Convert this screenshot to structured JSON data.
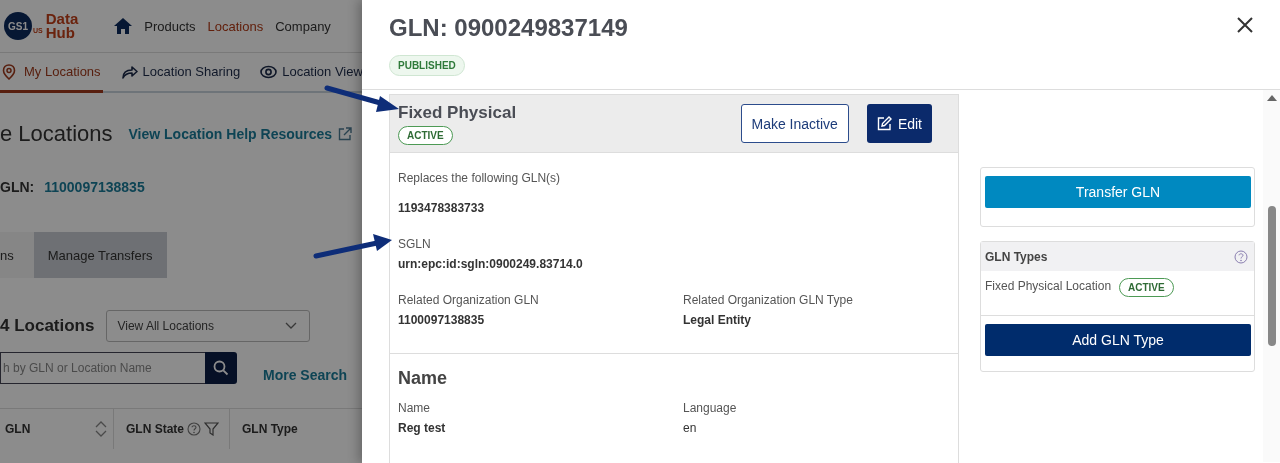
{
  "background_page": {
    "logo": {
      "mark": "GS1",
      "region": "US",
      "product": "Data Hub"
    },
    "nav": [
      {
        "label": "Products",
        "selected": false
      },
      {
        "label": "Locations",
        "selected": true
      },
      {
        "label": "Company",
        "selected": false
      }
    ],
    "subnav": [
      {
        "label": "My Locations",
        "selected": true
      },
      {
        "label": "Location Sharing",
        "selected": false
      },
      {
        "label": "Location View",
        "selected": false
      }
    ],
    "page_title": "e Locations",
    "help_link": "View Location Help Resources",
    "gln_label": "GLN:",
    "gln_value": "1100097138835",
    "tabs": [
      {
        "label": "ns",
        "selected": true
      },
      {
        "label": "Manage Transfers",
        "selected": false
      }
    ],
    "count": "4 Locations",
    "view_select": "View All Locations",
    "search": {
      "placeholder": "h by GLN or Location Name"
    },
    "more_search": "More Search",
    "columns": [
      "GLN",
      "GLN State",
      "GLN Type"
    ]
  },
  "drawer": {
    "title": "GLN: 0900249837149",
    "status": "PUBLISHED",
    "gln_type_card": {
      "title": "Fixed Physical",
      "status": "ACTIVE",
      "buttons": [
        {
          "label": "Make Inactive",
          "kind": "outline"
        },
        {
          "label": "Edit",
          "kind": "primary"
        }
      ],
      "fields": [
        {
          "label": "Replaces the following GLN(s)",
          "value": "1193478383733",
          "kind": "wide"
        },
        {
          "label": "SGLN",
          "value": "urn:epc:id:sgln:0900249.83714.0",
          "kind": "wide"
        },
        {
          "label": "Related Organization GLN",
          "value": "1100097138835",
          "kind": "half"
        },
        {
          "label": "Related Organization GLN Type",
          "value": "Legal Entity",
          "kind": "half"
        }
      ]
    },
    "name_section": {
      "title": "Name",
      "fields": [
        {
          "label": "Name",
          "value": "Reg test",
          "kind": "half"
        },
        {
          "label": "Language",
          "value": "en",
          "kind": "plain"
        }
      ]
    },
    "transfer_button": "Transfer GLN",
    "gln_types": {
      "title": "GLN Types",
      "items": [
        {
          "name": "Fixed Physical Location",
          "status": "ACTIVE"
        }
      ],
      "add_button": "Add GLN Type"
    }
  }
}
